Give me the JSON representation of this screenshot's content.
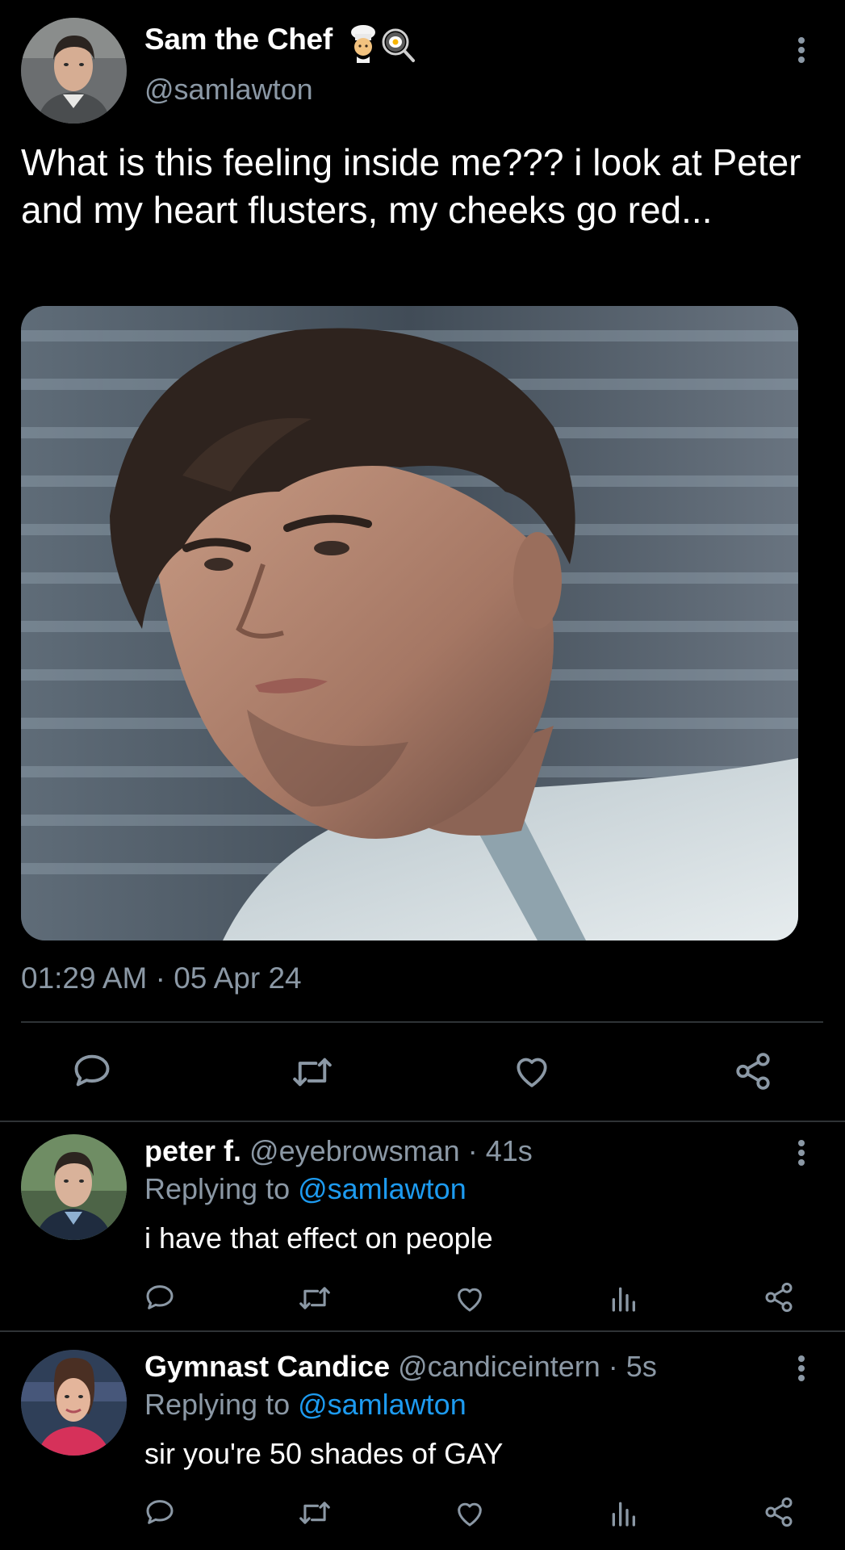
{
  "main_tweet": {
    "author_name": "Sam the Chef",
    "name_emoji": [
      "chef-emoji",
      "frying-pan-emoji"
    ],
    "handle": "@samlawton",
    "text": "What is this feeling inside me??? i look at Peter and my heart flusters, my cheeks go red...",
    "timestamp": "01:29 AM · 05 Apr 24",
    "media_icon": "photo-close-up-man"
  },
  "actions": {
    "reply_icon": "reply-icon",
    "retweet_icon": "retweet-icon",
    "like_icon": "like-icon",
    "share_icon": "share-icon",
    "views_icon": "views-icon",
    "more_icon": "more-options-icon"
  },
  "replies": [
    {
      "name": "peter f.",
      "handle": "@eyebrowsman",
      "time": "41s",
      "meta": "@eyebrowsman · 41s",
      "replying_prefix": "Replying to ",
      "replying_to": "@samlawton",
      "text": "i have that effect on people"
    },
    {
      "name": "Gymnast Candice",
      "handle": "@candiceintern",
      "time": "5s",
      "meta": "@candiceintern · 5s",
      "replying_prefix": "Replying to ",
      "replying_to": "@samlawton",
      "text": "sir you're 50 shades of GAY"
    }
  ],
  "colors": {
    "background": "#000000",
    "primary_text": "#ffffff",
    "secondary_text": "#8b98a5",
    "link": "#1d9bf0",
    "divider": "#2f3336"
  }
}
